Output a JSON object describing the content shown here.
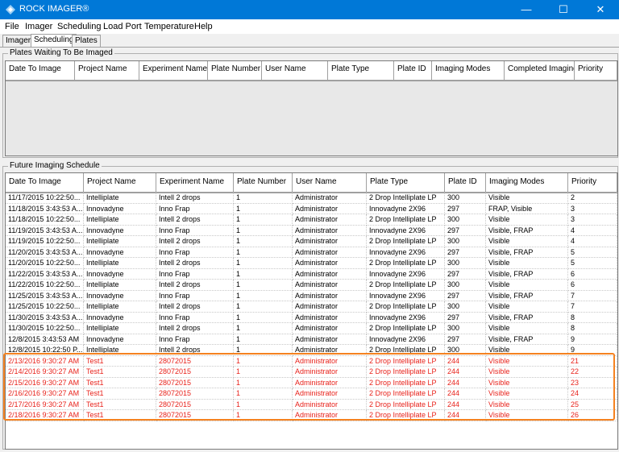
{
  "window": {
    "title": "ROCK IMAGER®",
    "minimize": "—",
    "maximize": "☐",
    "close": "✕"
  },
  "menu": [
    "File",
    "Imager",
    "Scheduling",
    "Load Port",
    "Temperature",
    "Help"
  ],
  "tabs": [
    {
      "label": "Imager",
      "active": false
    },
    {
      "label": "Scheduling",
      "active": true
    },
    {
      "label": "Plates",
      "active": false
    }
  ],
  "waiting": {
    "legend": "Plates Waiting To Be Imaged",
    "columns": [
      "Date To Image",
      "Project Name",
      "Experiment Name",
      "Plate Number",
      "User Name",
      "Plate Type",
      "Plate ID",
      "Imaging Modes",
      "Completed Imaging",
      "Priority"
    ]
  },
  "future": {
    "legend": "Future Imaging Schedule",
    "columns": [
      "Date To Image",
      "Project Name",
      "Experiment Name",
      "Plate Number",
      "User Name",
      "Plate Type",
      "Plate ID",
      "Imaging Modes",
      "Priority"
    ],
    "rows": [
      [
        "11/17/2015  10:22:50...",
        "Intelliplate",
        "Intell 2 drops",
        "1",
        "Administrator",
        "2 Drop Intelliplate LP",
        "300",
        "Visible",
        "2"
      ],
      [
        "11/18/2015  3:43:53 A...",
        "Innovadyne",
        "Inno Frap",
        "1",
        "Administrator",
        "Innovadyne 2X96",
        "297",
        "FRAP, Visible",
        "3"
      ],
      [
        "11/18/2015  10:22:50...",
        "Intelliplate",
        "Intell 2 drops",
        "1",
        "Administrator",
        "2 Drop Intelliplate LP",
        "300",
        "Visible",
        "3"
      ],
      [
        "11/19/2015  3:43:53 A...",
        "Innovadyne",
        "Inno Frap",
        "1",
        "Administrator",
        "Innovadyne 2X96",
        "297",
        "Visible, FRAP",
        "4"
      ],
      [
        "11/19/2015  10:22:50...",
        "Intelliplate",
        "Intell 2 drops",
        "1",
        "Administrator",
        "2 Drop Intelliplate LP",
        "300",
        "Visible",
        "4"
      ],
      [
        "11/20/2015  3:43:53 A...",
        "Innovadyne",
        "Inno Frap",
        "1",
        "Administrator",
        "Innovadyne 2X96",
        "297",
        "Visible, FRAP",
        "5"
      ],
      [
        "11/20/2015  10:22:50...",
        "Intelliplate",
        "Intell 2 drops",
        "1",
        "Administrator",
        "2 Drop Intelliplate LP",
        "300",
        "Visible",
        "5"
      ],
      [
        "11/22/2015  3:43:53 A...",
        "Innovadyne",
        "Inno Frap",
        "1",
        "Administrator",
        "Innovadyne 2X96",
        "297",
        "Visible, FRAP",
        "6"
      ],
      [
        "11/22/2015  10:22:50...",
        "Intelliplate",
        "Intell 2 drops",
        "1",
        "Administrator",
        "2 Drop Intelliplate LP",
        "300",
        "Visible",
        "6"
      ],
      [
        "11/25/2015  3:43:53 A...",
        "Innovadyne",
        "Inno Frap",
        "1",
        "Administrator",
        "Innovadyne 2X96",
        "297",
        "Visible, FRAP",
        "7"
      ],
      [
        "11/25/2015  10:22:50...",
        "Intelliplate",
        "Intell 2 drops",
        "1",
        "Administrator",
        "2 Drop Intelliplate LP",
        "300",
        "Visible",
        "7"
      ],
      [
        "11/30/2015  3:43:53 A...",
        "Innovadyne",
        "Inno Frap",
        "1",
        "Administrator",
        "Innovadyne 2X96",
        "297",
        "Visible, FRAP",
        "8"
      ],
      [
        "11/30/2015  10:22:50...",
        "Intelliplate",
        "Intell 2 drops",
        "1",
        "Administrator",
        "2 Drop Intelliplate LP",
        "300",
        "Visible",
        "8"
      ],
      [
        "12/8/2015  3:43:53 AM",
        "Innovadyne",
        "Inno Frap",
        "1",
        "Administrator",
        "Innovadyne 2X96",
        "297",
        "Visible, FRAP",
        "9"
      ],
      [
        "12/8/2015  10:22:50 P...",
        "Intelliplate",
        "Intell 2 drops",
        "1",
        "Administrator",
        "2 Drop Intelliplate LP",
        "300",
        "Visible",
        "9"
      ],
      [
        "2/13/2016 9:30:27 AM",
        "Test1",
        "28072015",
        "1",
        "Administrator",
        "2 Drop Intelliplate LP",
        "244",
        "Visible",
        "21"
      ],
      [
        "2/14/2016 9:30:27 AM",
        "Test1",
        "28072015",
        "1",
        "Administrator",
        "2 Drop Intelliplate LP",
        "244",
        "Visible",
        "22"
      ],
      [
        "2/15/2016 9:30:27 AM",
        "Test1",
        "28072015",
        "1",
        "Administrator",
        "2 Drop Intelliplate LP",
        "244",
        "Visible",
        "23"
      ],
      [
        "2/16/2016 9:30:27 AM",
        "Test1",
        "28072015",
        "1",
        "Administrator",
        "2 Drop Intelliplate LP",
        "244",
        "Visible",
        "24"
      ],
      [
        "2/17/2016 9:30:27 AM",
        "Test1",
        "28072015",
        "1",
        "Administrator",
        "2 Drop Intelliplate LP",
        "244",
        "Visible",
        "25"
      ],
      [
        "2/18/2016 9:30:27 AM",
        "Test1",
        "28072015",
        "1",
        "Administrator",
        "2 Drop Intelliplate LP",
        "244",
        "Visible",
        "26"
      ]
    ],
    "highlighted_row_count": 6,
    "alert_color": "#e8221b",
    "highlight_color": "#f58220"
  },
  "colors": {
    "titlebar": "#0078d7",
    "panel": "#f0f0f0"
  },
  "icons": {
    "app": "rock-imager-app-icon"
  }
}
